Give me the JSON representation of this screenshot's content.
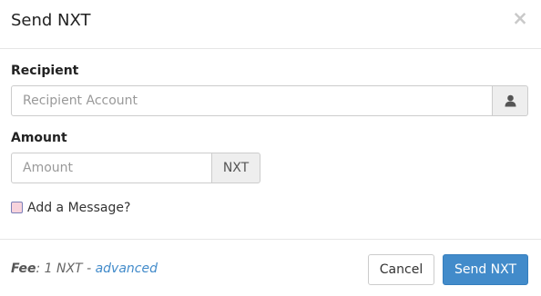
{
  "dialog": {
    "title": "Send NXT",
    "close_symbol": "×"
  },
  "recipient": {
    "label": "Recipient",
    "placeholder": "Recipient Account",
    "addon_icon": "user-icon"
  },
  "amount": {
    "label": "Amount",
    "placeholder": "Amount",
    "unit": "NXT"
  },
  "message_toggle": {
    "label": "Add a Message?",
    "checked": false
  },
  "footer": {
    "fee_label": "Fee",
    "fee_sep": ": ",
    "fee_value": "1 NXT - ",
    "advanced_link": "advanced",
    "cancel_label": "Cancel",
    "send_label": "Send NXT"
  },
  "colors": {
    "primary": "#428bca",
    "link": "#428bca"
  }
}
